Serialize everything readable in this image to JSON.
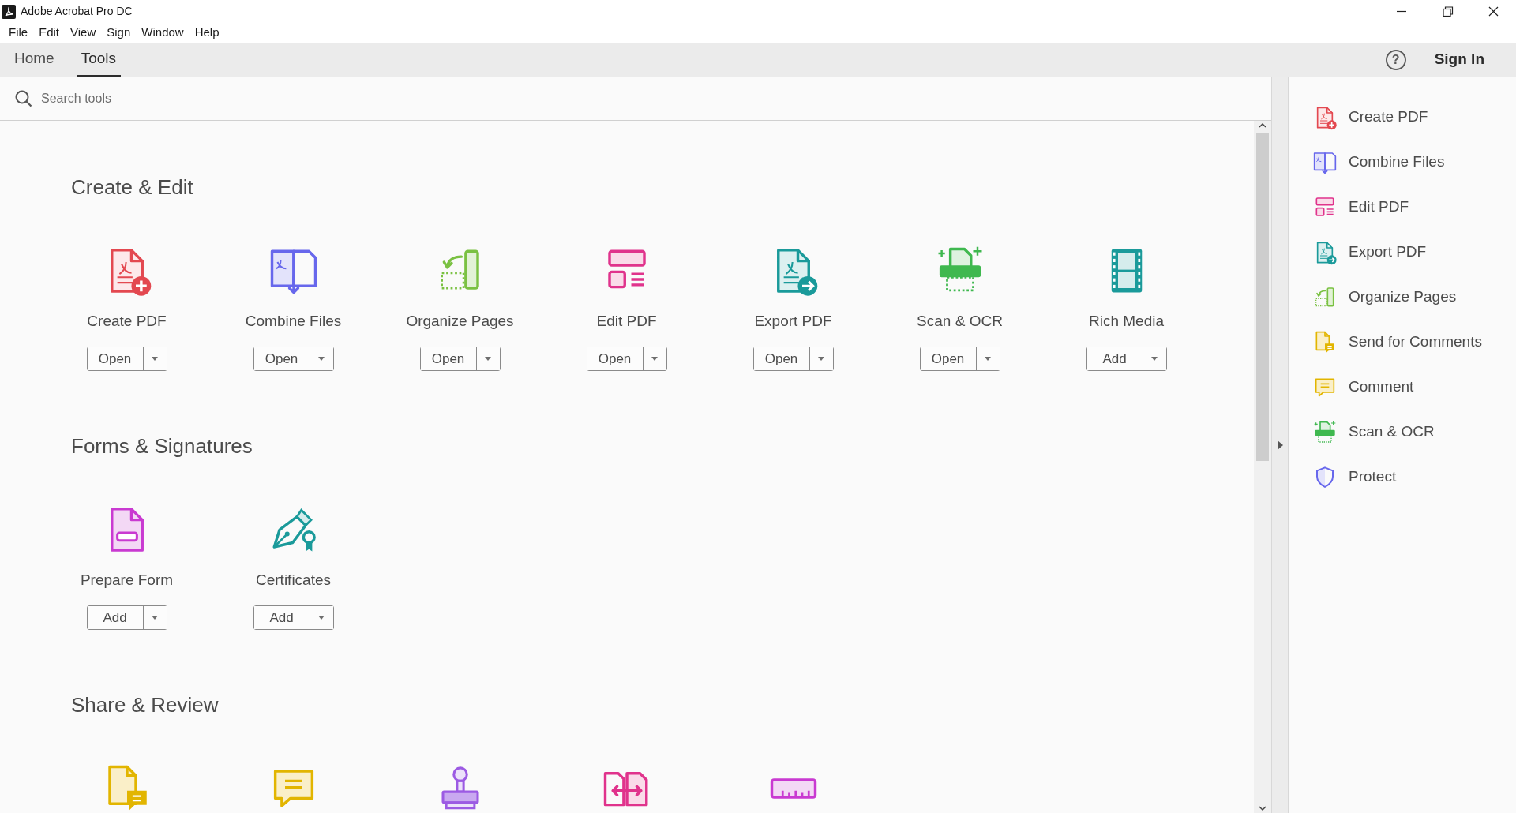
{
  "window": {
    "title": "Adobe Acrobat Pro DC"
  },
  "menu": [
    "File",
    "Edit",
    "View",
    "Sign",
    "Window",
    "Help"
  ],
  "tabs": [
    {
      "label": "Home",
      "selected": false
    },
    {
      "label": "Tools",
      "selected": true
    }
  ],
  "help": "?",
  "sign_in": "Sign In",
  "search": {
    "placeholder": "Search tools"
  },
  "sections": [
    {
      "title": "Create & Edit",
      "tools": [
        {
          "kind": "create-pdf",
          "label": "Create PDF",
          "button": "Open"
        },
        {
          "kind": "combine-files",
          "label": "Combine Files",
          "button": "Open"
        },
        {
          "kind": "organize-pages",
          "label": "Organize Pages",
          "button": "Open"
        },
        {
          "kind": "edit-pdf",
          "label": "Edit PDF",
          "button": "Open"
        },
        {
          "kind": "export-pdf",
          "label": "Export PDF",
          "button": "Open"
        },
        {
          "kind": "scan-ocr",
          "label": "Scan & OCR",
          "button": "Open"
        },
        {
          "kind": "rich-media",
          "label": "Rich Media",
          "button": "Add"
        }
      ]
    },
    {
      "title": "Forms & Signatures",
      "tools": [
        {
          "kind": "prepare-form",
          "label": "Prepare Form",
          "button": "Add"
        },
        {
          "kind": "certificates",
          "label": "Certificates",
          "button": "Add"
        }
      ]
    },
    {
      "title": "Share & Review",
      "tools": [
        {
          "kind": "send-for-comments"
        },
        {
          "kind": "comment"
        },
        {
          "kind": "stamp"
        },
        {
          "kind": "compare"
        },
        {
          "kind": "measure"
        }
      ]
    }
  ],
  "right_panel": {
    "items": [
      {
        "kind": "create-pdf",
        "label": "Create PDF"
      },
      {
        "kind": "combine-files",
        "label": "Combine Files"
      },
      {
        "kind": "edit-pdf",
        "label": "Edit PDF"
      },
      {
        "kind": "export-pdf",
        "label": "Export PDF"
      },
      {
        "kind": "organize-pages",
        "label": "Organize Pages"
      },
      {
        "kind": "send-for-comments",
        "label": "Send for Comments"
      },
      {
        "kind": "comment",
        "label": "Comment"
      },
      {
        "kind": "scan-ocr",
        "label": "Scan & OCR"
      },
      {
        "kind": "protect",
        "label": "Protect"
      }
    ]
  }
}
